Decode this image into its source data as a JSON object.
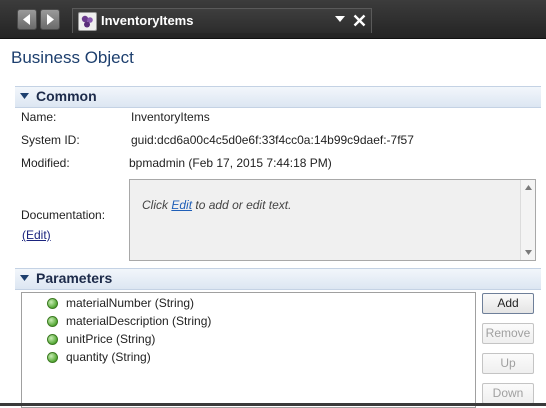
{
  "tab": {
    "title": "InventoryItems",
    "icon": "business-object-icon"
  },
  "page_title": "Business Object",
  "common": {
    "header": "Common",
    "name_label": "Name:",
    "name_value": "InventoryItems",
    "system_id_label": "System ID:",
    "system_id_value": "guid:dcd6a00c4c5d0e6f:33f4cc0a:14b99c9daef:-7f57",
    "modified_label": "Modified:",
    "modified_value": "bpmadmin (Feb 17, 2015 7:44:18 PM)",
    "documentation_label": "Documentation:",
    "documentation_edit_link": "(Edit)",
    "doc_prefix": "Click ",
    "doc_link": "Edit",
    "doc_suffix": " to add or edit text."
  },
  "parameters": {
    "header": "Parameters",
    "items": [
      "materialNumber (String)",
      "materialDescription (String)",
      "unitPrice (String)",
      "quantity (String)"
    ],
    "buttons": {
      "add": "Add",
      "remove": "Remove",
      "up": "Up",
      "down": "Down"
    }
  },
  "colors": {
    "title_blue": "#1d3f6e",
    "section_bg": "#dce6f2",
    "param_dot": "#55a935"
  }
}
